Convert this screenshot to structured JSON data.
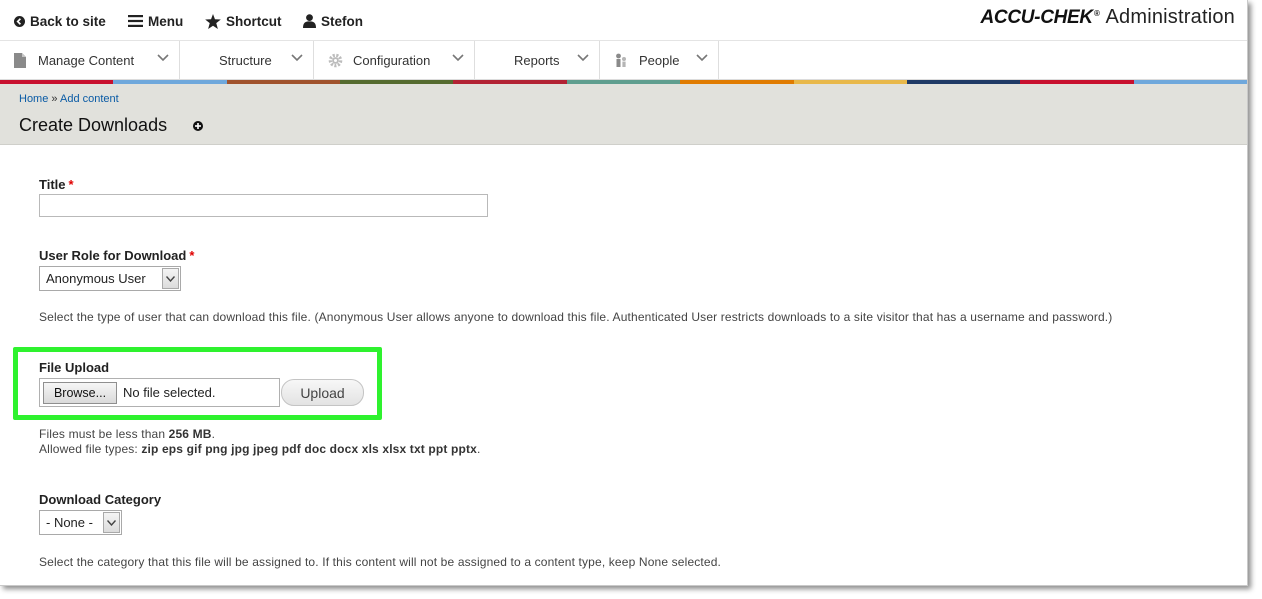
{
  "toolbar": {
    "back_label": "Back to site",
    "menu_label": "Menu",
    "shortcut_label": "Shortcut",
    "user_label": "Stefon",
    "brand_logo": "ACCU-CHEK",
    "brand_suffix": "Administration"
  },
  "tray": {
    "items": [
      {
        "label": "Manage Content",
        "icon": "document-icon"
      },
      {
        "label": "Structure",
        "icon": ""
      },
      {
        "label": "Configuration",
        "icon": "gear-icon"
      },
      {
        "label": "Reports",
        "icon": ""
      },
      {
        "label": "People",
        "icon": "people-icon"
      }
    ]
  },
  "stripe_colors": [
    "#c8102e",
    "#6fa8dc",
    "#a0522d",
    "#556b2f",
    "#b22234",
    "#5f9e8f",
    "#e07b00",
    "#e8b84a",
    "#1f3a66",
    "#c8102e",
    "#6fa8dc"
  ],
  "breadcrumb": {
    "home": "Home",
    "separator": "»",
    "current": "Add content"
  },
  "page": {
    "title": "Create Downloads"
  },
  "form": {
    "title_label": "Title",
    "title_value": "",
    "role_label": "User Role for Download",
    "role_value": "Anonymous User",
    "role_desc": "Select the type of user that can download this file. (Anonymous User allows anyone to download this file. Authenticated User restricts downloads to a site visitor that has a username and password.)",
    "file_label": "File Upload",
    "browse_label": "Browse...",
    "no_file_text": "No file selected.",
    "upload_label": "Upload",
    "size_prefix": "Files must be less than",
    "size_value": "256 MB",
    "types_prefix": "Allowed file types:",
    "types_value": "zip eps gif png jpg jpeg pdf doc docx xls xlsx txt ppt pptx",
    "category_label": "Download Category",
    "category_value": "- None -",
    "category_desc": "Select the category that this file will be assigned to. If this content will not be assigned to a content type, keep None selected.",
    "required_mark": "*"
  },
  "colors": {
    "highlight": "#2ef22e",
    "link": "#0a5ba5",
    "required": "#e00000",
    "header_bg": "#e1e1dc"
  }
}
